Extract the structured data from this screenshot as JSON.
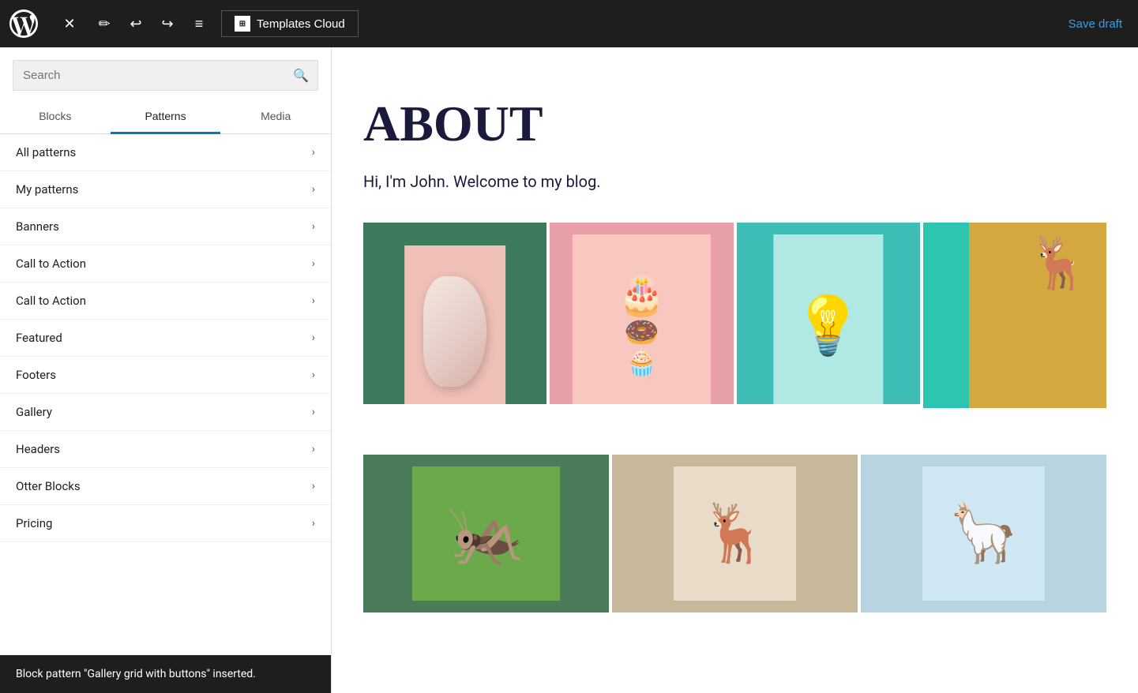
{
  "toolbar": {
    "wp_logo_alt": "WordPress",
    "close_label": "✕",
    "edit_icon_label": "✏",
    "undo_icon_label": "↩",
    "redo_icon_label": "↪",
    "list_icon_label": "≡",
    "templates_cloud_label": "Templates Cloud",
    "save_draft_label": "Save draft"
  },
  "sidebar": {
    "search_placeholder": "Search",
    "tabs": [
      {
        "id": "blocks",
        "label": "Blocks"
      },
      {
        "id": "patterns",
        "label": "Patterns"
      },
      {
        "id": "media",
        "label": "Media"
      }
    ],
    "active_tab": "patterns",
    "items": [
      {
        "id": "all-patterns",
        "label": "All patterns"
      },
      {
        "id": "my-patterns",
        "label": "My patterns"
      },
      {
        "id": "banners",
        "label": "Banners"
      },
      {
        "id": "call-to-action-1",
        "label": "Call to Action"
      },
      {
        "id": "call-to-action-2",
        "label": "Call to Action"
      },
      {
        "id": "featured",
        "label": "Featured"
      },
      {
        "id": "footers",
        "label": "Footers"
      },
      {
        "id": "gallery",
        "label": "Gallery"
      },
      {
        "id": "headers",
        "label": "Headers"
      },
      {
        "id": "otter-blocks",
        "label": "Otter Blocks"
      },
      {
        "id": "pricing",
        "label": "Pricing"
      }
    ]
  },
  "toast": {
    "message": "Block pattern \"Gallery grid with buttons\" inserted."
  },
  "content": {
    "title": "ABOUT",
    "subtitle": "Hi, I'm John. Welcome to my blog."
  }
}
